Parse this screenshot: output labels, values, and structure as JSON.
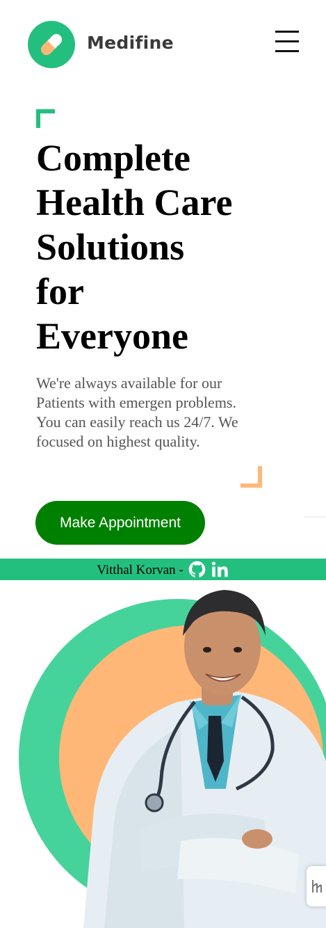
{
  "brand": {
    "name": "Medifine",
    "logo_icon": "capsule-icon",
    "accent_color": "#23bf7f"
  },
  "nav": {
    "menu_icon": "hamburger-menu-icon"
  },
  "hero": {
    "title_lines": [
      "Complete",
      "Health Care",
      "Solutions",
      "for",
      "Everyone"
    ],
    "description": "We're always available for our Patients with emergen problems. You can easily reach us 24/7. We focused on highest quality.",
    "cta_label": "Make Appointment",
    "cta_color": "#008000",
    "image": "smiling-doctor-with-stethoscope-photo",
    "circle_colors": [
      "#45d39b",
      "#ffb778"
    ]
  },
  "credit": {
    "text": "Vitthal Korvan -",
    "icons": [
      "github-icon",
      "linkedin-icon"
    ]
  },
  "widget": {
    "icon": "side-widget-icon"
  }
}
